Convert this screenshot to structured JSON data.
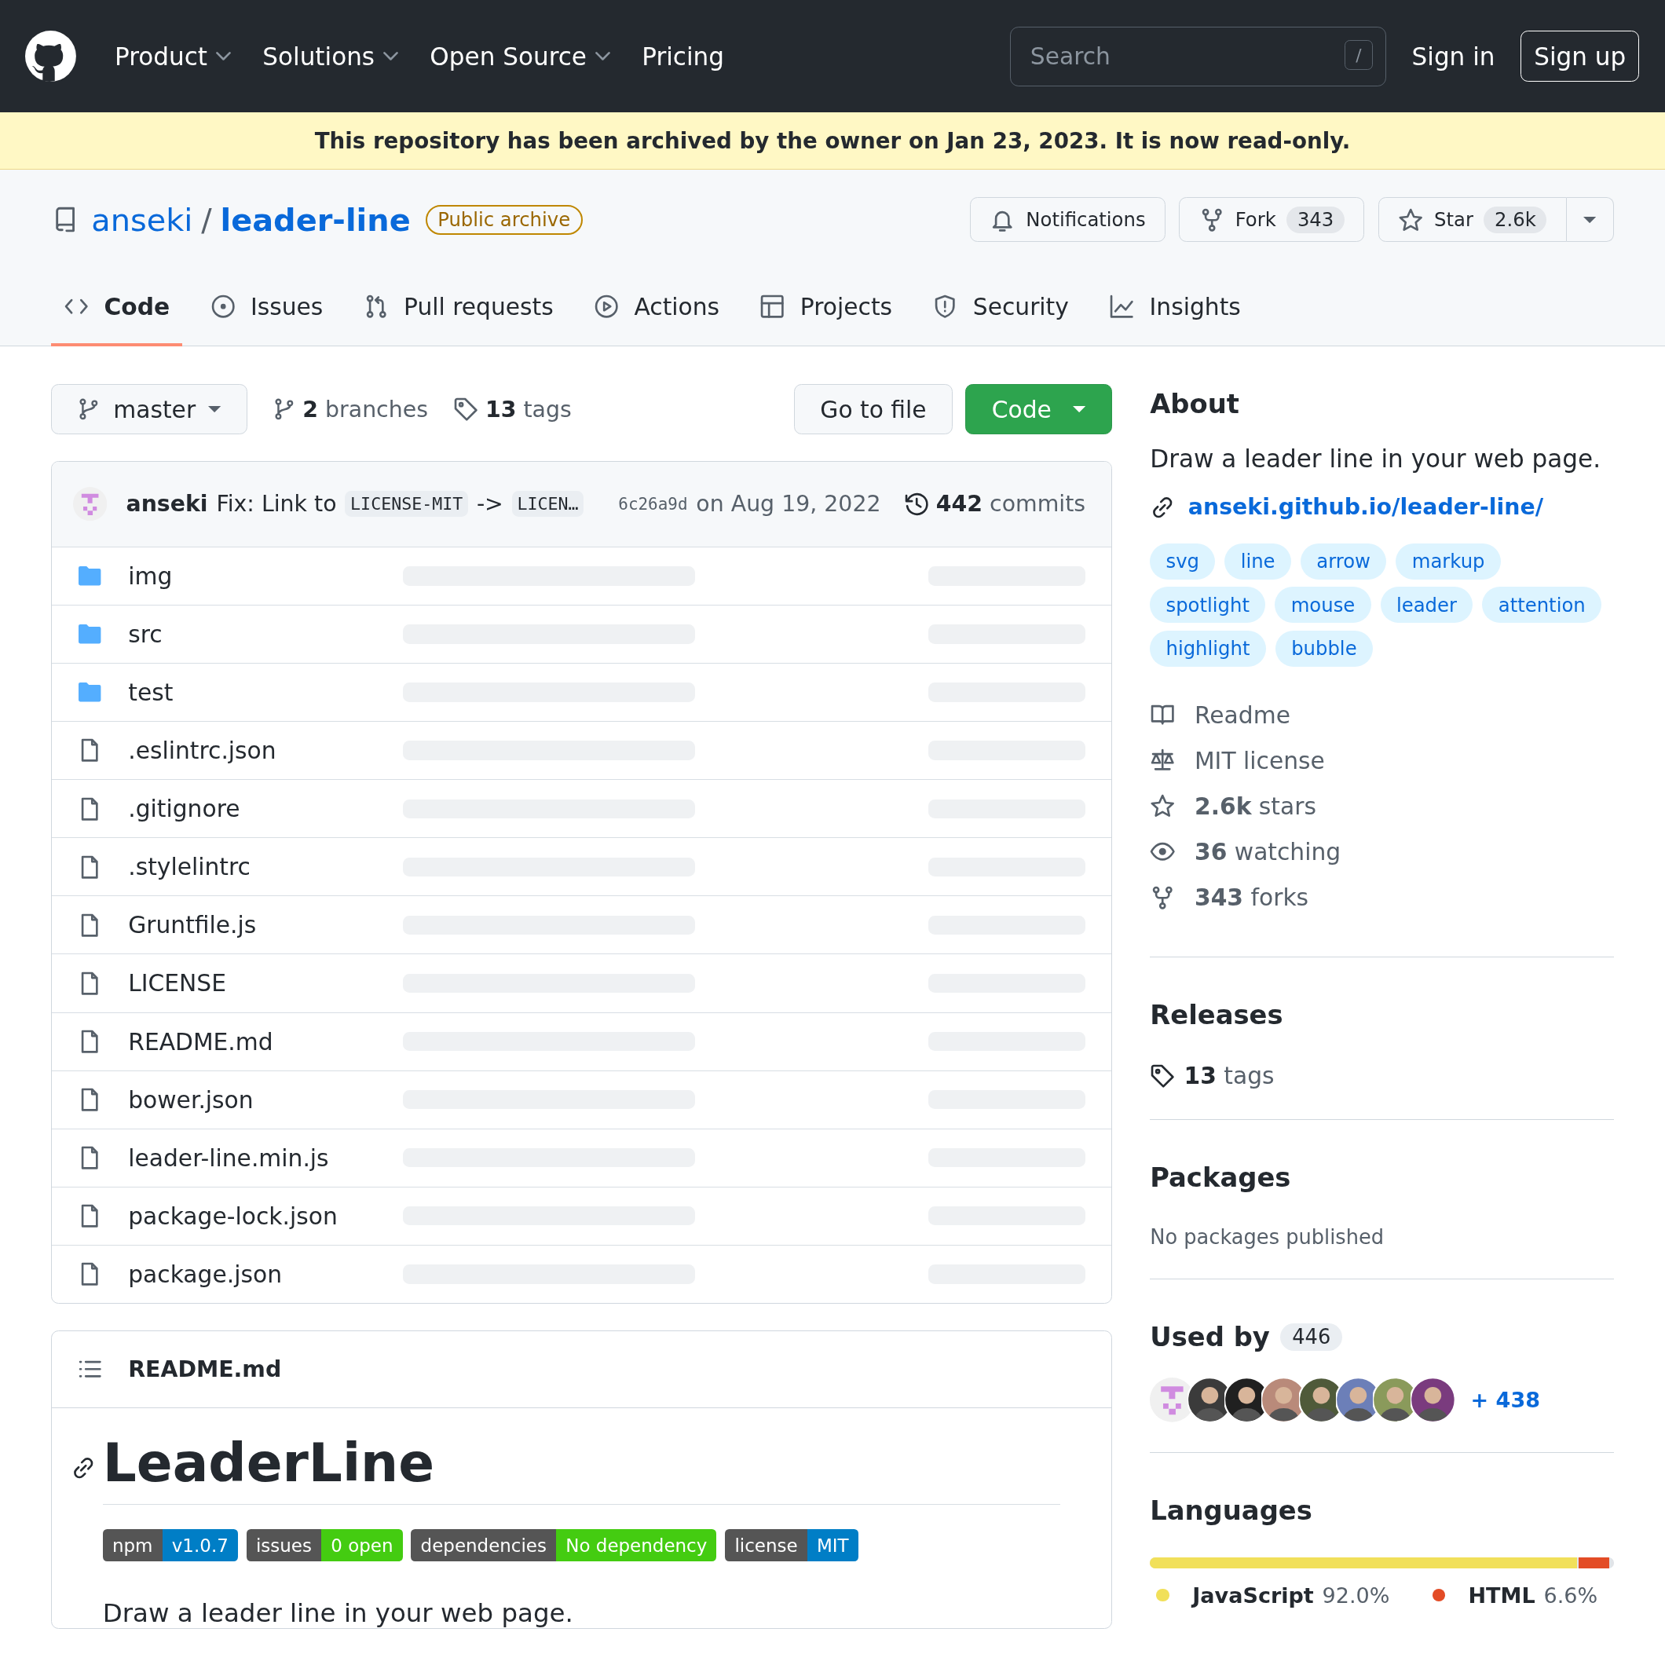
{
  "header": {
    "nav": [
      {
        "label": "Product",
        "dropdown": true
      },
      {
        "label": "Solutions",
        "dropdown": true
      },
      {
        "label": "Open Source",
        "dropdown": true
      },
      {
        "label": "Pricing",
        "dropdown": false
      }
    ],
    "search": {
      "placeholder": "Search",
      "shortcut": "/"
    },
    "sign_in": "Sign in",
    "sign_up": "Sign up"
  },
  "banner": "This repository has been archived by the owner on Jan 23, 2023. It is now read-only.",
  "repo": {
    "owner": "anseki",
    "separator": "/",
    "name": "leader-line",
    "badge": "Public archive",
    "actions": [
      {
        "label": "Notifications",
        "menu": false
      },
      {
        "label": "Fork",
        "count": "343",
        "menu": false
      },
      {
        "label": "Star",
        "count": "2.6k",
        "menu": true
      }
    ]
  },
  "tabs": [
    {
      "label": "Code",
      "selected": true
    },
    {
      "label": "Issues",
      "selected": false
    },
    {
      "label": "Pull requests",
      "selected": false
    },
    {
      "label": "Actions",
      "selected": false
    },
    {
      "label": "Projects",
      "selected": false
    },
    {
      "label": "Security",
      "selected": false
    },
    {
      "label": "Insights",
      "selected": false
    }
  ],
  "toolbar": {
    "branch": "master",
    "branches": "**2** branches",
    "tags": "**13** tags",
    "go_to_file": "Go to file",
    "code_button": "Code"
  },
  "commit": {
    "author": "anseki",
    "message": [
      {
        "kind": "text",
        "text": "Fix: Link to"
      },
      {
        "kind": "code",
        "text": "LICENSE-MIT"
      },
      {
        "kind": "text",
        "text": "->"
      },
      {
        "kind": "code",
        "text": "LICEN…"
      }
    ],
    "hash": "6c26a9d",
    "date": "on Aug 19, 2022",
    "commits": "**442** commits"
  },
  "files": [
    {
      "name": "img",
      "kind": "folder"
    },
    {
      "name": "src",
      "kind": "folder"
    },
    {
      "name": "test",
      "kind": "folder"
    },
    {
      "name": ".eslintrc.json",
      "kind": "file"
    },
    {
      "name": ".gitignore",
      "kind": "file"
    },
    {
      "name": ".stylelintrc",
      "kind": "file"
    },
    {
      "name": "Gruntfile.js",
      "kind": "file"
    },
    {
      "name": "LICENSE",
      "kind": "file"
    },
    {
      "name": "README.md",
      "kind": "file"
    },
    {
      "name": "bower.json",
      "kind": "file"
    },
    {
      "name": "leader-line.min.js",
      "kind": "file"
    },
    {
      "name": "package-lock.json",
      "kind": "file"
    },
    {
      "name": "package.json",
      "kind": "file"
    }
  ],
  "readme": {
    "filename": "README.md",
    "title": "LeaderLine",
    "badges": [
      {
        "label": "npm",
        "value": "v1.0.7",
        "color": "#007ec6"
      },
      {
        "label": "issues",
        "value": "0 open",
        "color": "#44cc11"
      },
      {
        "label": "dependencies",
        "value": "No dependency",
        "color": "#44cc11"
      },
      {
        "label": "license",
        "value": "MIT",
        "color": "#007ec6"
      }
    ],
    "text": "Draw a leader line in your web page."
  },
  "about": {
    "title": "About",
    "description": "Draw a leader line in your web page.",
    "link": "anseki.github.io/leader-line/",
    "topics": [
      "svg",
      "line",
      "arrow",
      "markup",
      "spotlight",
      "mouse",
      "leader",
      "attention",
      "highlight",
      "bubble"
    ],
    "meta": [
      "Readme",
      "MIT license",
      "**2.6k** stars",
      "**36** watching",
      "**343** forks"
    ]
  },
  "releases": {
    "title": "Releases",
    "tags": "**13** tags"
  },
  "packages": {
    "title": "Packages",
    "text": "No packages published"
  },
  "used_by": {
    "title": "Used by",
    "count": "446",
    "avatars": [
      {
        "kind": "identicon"
      },
      {
        "kind": "photo"
      },
      {
        "kind": "photo"
      },
      {
        "kind": "photo"
      },
      {
        "kind": "photo"
      },
      {
        "kind": "photo"
      },
      {
        "kind": "photo"
      },
      {
        "kind": "photo"
      }
    ],
    "more": "+ 438"
  },
  "languages": {
    "title": "Languages",
    "items": [
      {
        "name": "JavaScript",
        "percent": "92.0%",
        "color": "#f1e05a",
        "level": 0.92
      },
      {
        "name": "HTML",
        "percent": "6.6%",
        "color": "#e34c26",
        "level": 0.066
      }
    ]
  }
}
